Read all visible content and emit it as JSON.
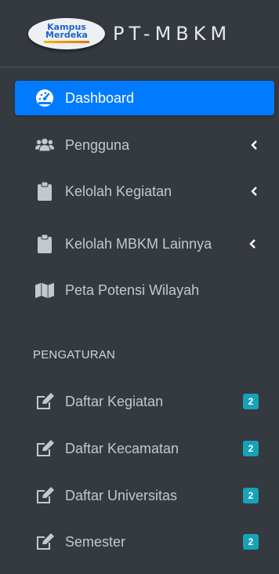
{
  "brand": {
    "logo_line1": "Kampus",
    "logo_line2": "Merdeka",
    "title": "PT-MBKM"
  },
  "nav": {
    "dashboard": "Dashboard",
    "pengguna": "Pengguna",
    "kelolah_kegiatan": "Kelolah Kegiatan",
    "kelolah_mbkm": "Kelolah MBKM Lainnya",
    "peta": "Peta Potensi Wilayah"
  },
  "section_header": "PENGATURAN",
  "settings": [
    {
      "label": "Daftar Kegiatan",
      "badge": "2"
    },
    {
      "label": "Daftar Kecamatan",
      "badge": "2"
    },
    {
      "label": "Daftar Universitas",
      "badge": "2"
    },
    {
      "label": "Semester",
      "badge": "2"
    }
  ],
  "colors": {
    "sidebar_bg": "#343a40",
    "active_bg": "#007bff",
    "badge_bg": "#17a2b8",
    "text": "#c2c7d0"
  },
  "icons": {
    "dashboard": "tachometer-icon",
    "pengguna": "users-icon",
    "kelolah": "clipboard-icon",
    "peta": "map-icon",
    "settings": "edit-icon",
    "chevron": "chevron-left-icon"
  }
}
